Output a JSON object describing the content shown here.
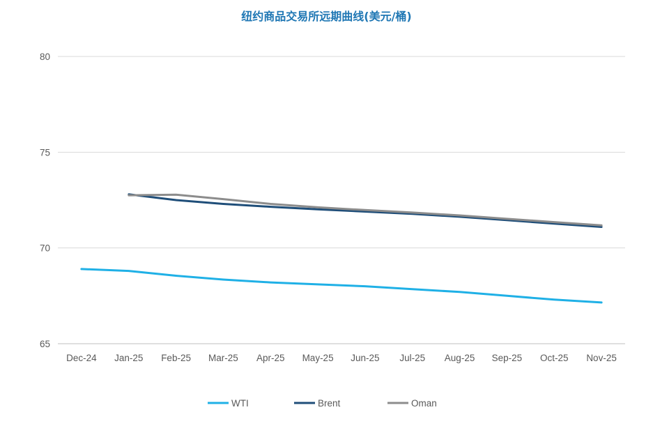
{
  "chart_data": {
    "type": "line",
    "title": "纽约商品交易所远期曲线(美元/桶)",
    "xlabel": "",
    "ylabel": "",
    "categories": [
      "Dec-24",
      "Jan-25",
      "Feb-25",
      "Mar-25",
      "Apr-25",
      "May-25",
      "Jun-25",
      "Jul-25",
      "Aug-25",
      "Sep-25",
      "Oct-25",
      "Nov-25"
    ],
    "ylim": [
      65,
      80
    ],
    "yticks": [
      65,
      70,
      75,
      80
    ],
    "grid": true,
    "legend_position": "bottom",
    "series": [
      {
        "name": "WTI",
        "color": "#1fb0e6",
        "values": [
          68.9,
          68.8,
          68.55,
          68.35,
          68.2,
          68.1,
          68.0,
          67.85,
          67.7,
          67.5,
          67.3,
          67.15
        ]
      },
      {
        "name": "Brent",
        "color": "#1f4e79",
        "values": [
          null,
          72.8,
          72.5,
          72.3,
          72.15,
          72.02,
          71.9,
          71.78,
          71.63,
          71.45,
          71.27,
          71.1
        ]
      },
      {
        "name": "Oman",
        "color": "#8c8c8c",
        "values": [
          null,
          72.75,
          72.78,
          72.55,
          72.3,
          72.12,
          71.98,
          71.85,
          71.7,
          71.52,
          71.35,
          71.18
        ]
      }
    ]
  }
}
